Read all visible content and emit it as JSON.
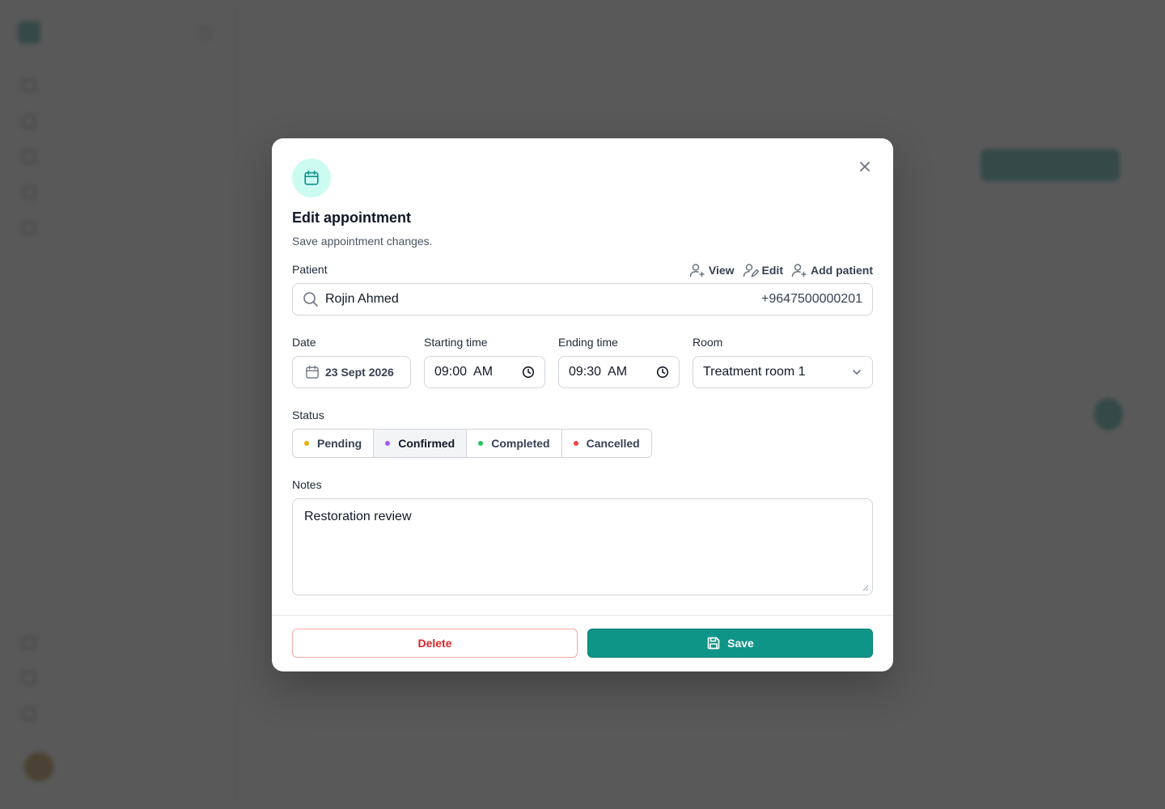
{
  "modal": {
    "title": "Edit appointment",
    "subtitle": "Save appointment changes.",
    "close_icon": "close-icon",
    "header_icon": "calendar-icon",
    "patient": {
      "label": "Patient",
      "actions": [
        {
          "label": "View",
          "icon": "user-view-icon"
        },
        {
          "label": "Edit",
          "icon": "user-edit-icon"
        },
        {
          "label": "Add patient",
          "icon": "user-add-icon"
        }
      ],
      "name": "Rojin Ahmed",
      "phone": "+9647500000201"
    },
    "date": {
      "label": "Date",
      "value": "23 Sept 2026"
    },
    "start_time": {
      "label": "Starting time",
      "value": "09:00  AM"
    },
    "end_time": {
      "label": "Ending time",
      "value": "09:30  AM"
    },
    "room": {
      "label": "Room",
      "value": "Treatment room 1"
    },
    "status": {
      "label": "Status",
      "selected": "Confirmed",
      "options": [
        {
          "label": "Pending",
          "color": "#eab308"
        },
        {
          "label": "Confirmed",
          "color": "#a855f7"
        },
        {
          "label": "Completed",
          "color": "#22c55e"
        },
        {
          "label": "Cancelled",
          "color": "#ef4444"
        }
      ]
    },
    "notes": {
      "label": "Notes",
      "value": "Restoration review"
    },
    "delete_label": "Delete",
    "save_label": "Save"
  },
  "colors": {
    "accent": "#0f9488",
    "accent_light": "#ccfbf1",
    "danger": "#dc2626",
    "overlay": "#595959"
  }
}
